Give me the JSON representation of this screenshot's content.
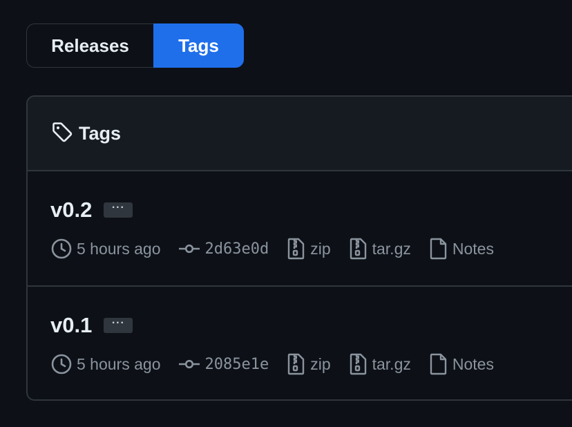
{
  "tabs": {
    "releases_label": "Releases",
    "tags_label": "Tags",
    "active": "tags"
  },
  "box": {
    "header_title": "Tags"
  },
  "tags": [
    {
      "name": "v0.2",
      "more_label": "···",
      "time": "5 hours ago",
      "commit": "2d63e0d",
      "zip_label": "zip",
      "targz_label": "tar.gz",
      "notes_label": "Notes"
    },
    {
      "name": "v0.1",
      "more_label": "···",
      "time": "5 hours ago",
      "commit": "2085e1e",
      "zip_label": "zip",
      "targz_label": "tar.gz",
      "notes_label": "Notes"
    }
  ],
  "colors": {
    "background": "#0d1117",
    "accent": "#1f6feb",
    "border": "#30363d",
    "muted_text": "#8b949e"
  },
  "icons": [
    "tag-icon",
    "clock-icon",
    "commit-icon",
    "file-zip-icon",
    "file-icon"
  ]
}
